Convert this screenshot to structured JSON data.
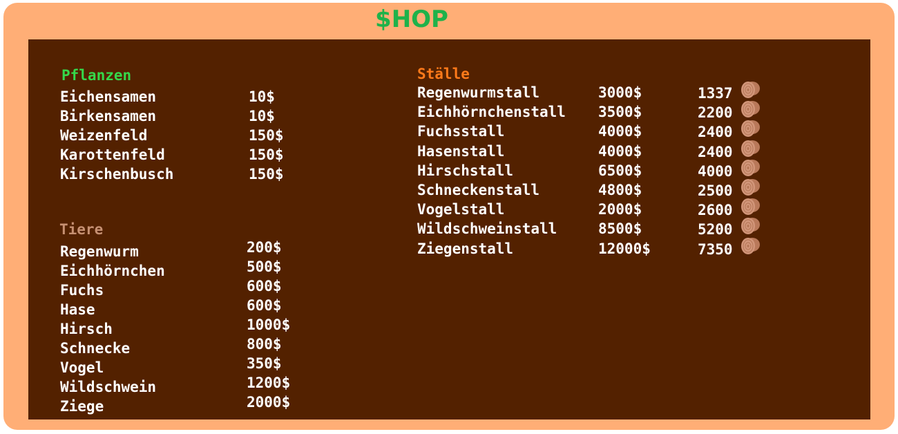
{
  "title": "$HOP",
  "colors": {
    "frame": "#FFAE76",
    "panel": "#532100",
    "title": "#1FB24A",
    "pflanzen": "#35D84A",
    "tiere": "#C69072",
    "staelle": "#FF7A1A",
    "text": "#FFFFFF"
  },
  "pflanzen": {
    "heading": "Pflanzen",
    "items": [
      {
        "name": "Eichensamen",
        "price": "10$"
      },
      {
        "name": "Birkensamen",
        "price": "10$"
      },
      {
        "name": "Weizenfeld",
        "price": "150$"
      },
      {
        "name": "Karottenfeld",
        "price": "150$"
      },
      {
        "name": "Kirschenbusch",
        "price": "150$"
      }
    ]
  },
  "tiere": {
    "heading": "Tiere",
    "items": [
      {
        "name": "Regenwurm",
        "price": "200$"
      },
      {
        "name": "Eichhörnchen",
        "price": "500$"
      },
      {
        "name": "Fuchs",
        "price": "600$"
      },
      {
        "name": "Hase",
        "price": "600$"
      },
      {
        "name": "Hirsch",
        "price": "1000$"
      },
      {
        "name": "Schnecke",
        "price": "800$"
      },
      {
        "name": "Vogel",
        "price": "350$"
      },
      {
        "name": "Wildschwein",
        "price": "1200$"
      },
      {
        "name": "Ziege",
        "price": "2000$"
      }
    ]
  },
  "staelle": {
    "heading": "Ställe",
    "wood_icon": "wood-log-icon",
    "items": [
      {
        "name": "Regenwurmstall",
        "price": "3000$",
        "wood": "1337"
      },
      {
        "name": "Eichhörnchenstall",
        "price": "3500$",
        "wood": "2200"
      },
      {
        "name": "Fuchsstall",
        "price": "4000$",
        "wood": "2400"
      },
      {
        "name": "Hasenstall",
        "price": "4000$",
        "wood": "2400"
      },
      {
        "name": "Hirschstall",
        "price": "6500$",
        "wood": "4000"
      },
      {
        "name": "Schneckenstall",
        "price": "4800$",
        "wood": "2500"
      },
      {
        "name": "Vogelstall",
        "price": "2000$",
        "wood": "2600"
      },
      {
        "name": "Wildschweinstall",
        "price": "8500$",
        "wood": "5200"
      },
      {
        "name": "Ziegenstall",
        "price": "12000$",
        "wood": "7350"
      }
    ]
  }
}
